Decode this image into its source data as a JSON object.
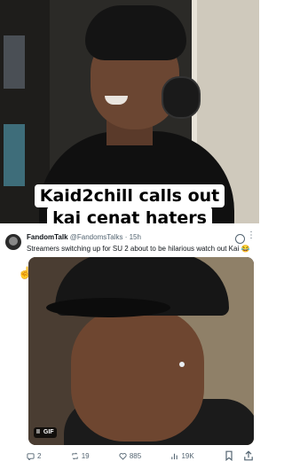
{
  "video": {
    "caption_line1": "Kaid2chill calls out",
    "caption_line2": "kai cenat haters"
  },
  "tweet": {
    "display_name": "FandomTalk",
    "handle": "@FandomsTalks",
    "separator": "·",
    "time": "15h",
    "text": "Streamers switching up for SU 2 about to be hilarious watch out Kai 😂",
    "media": {
      "badge_pause": "II",
      "badge_gif": "GIF"
    },
    "actions": {
      "replies": "2",
      "reposts": "19",
      "likes": "885",
      "views": "19K"
    }
  }
}
